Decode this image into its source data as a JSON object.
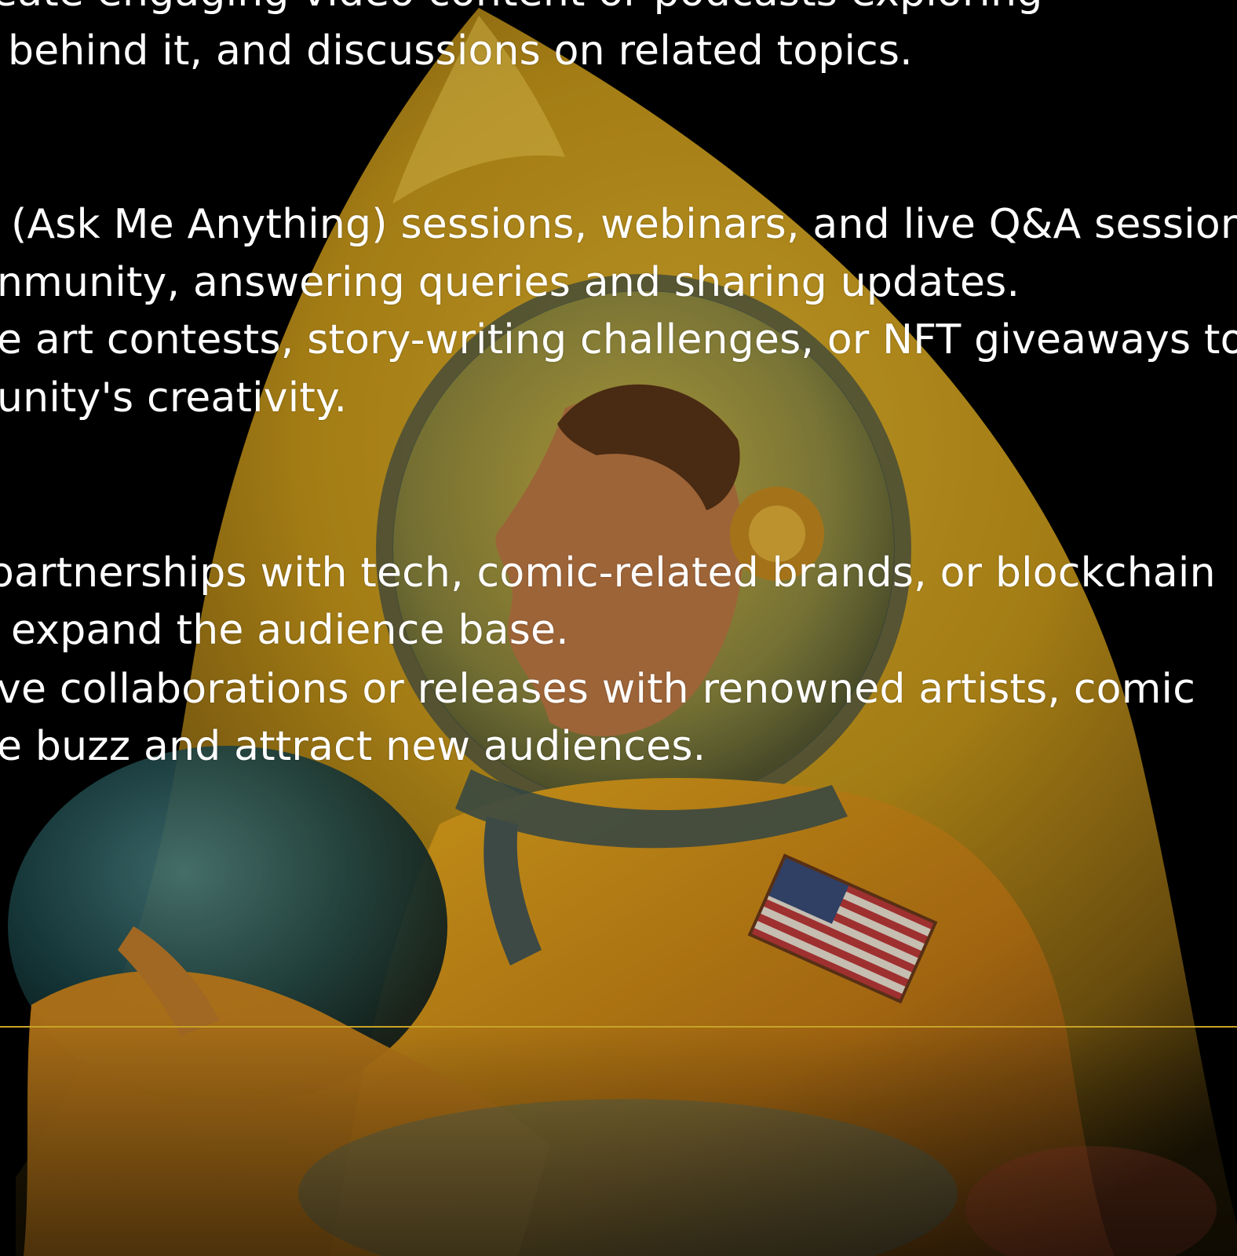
{
  "colors": {
    "background": "#000000",
    "text": "#ffffff",
    "divider": "#c9a227",
    "art_primary": "#e9b21e",
    "art_shadow": "#6b4a12",
    "art_cool": "#2e6f7a"
  },
  "content": {
    "lines": [
      "eate engaging video content or podcasts exploring",
      "behind it, and discussions on related topics.",
      "(Ask Me Anything) sessions, webinars, and live Q&A session",
      "nmunity, answering queries and sharing updates.",
      "e art contests, story-writing challenges, or NFT giveaways to",
      "unity's creativity.",
      "oartnerships with tech, comic-related brands, or blockchain",
      "expand the audience base.",
      "ve collaborations or releases with renowned artists, comic",
      "e buzz and attract new audiences."
    ]
  },
  "artwork": {
    "subject": "astronaut-illustration",
    "patch": "us-flag-patch"
  }
}
